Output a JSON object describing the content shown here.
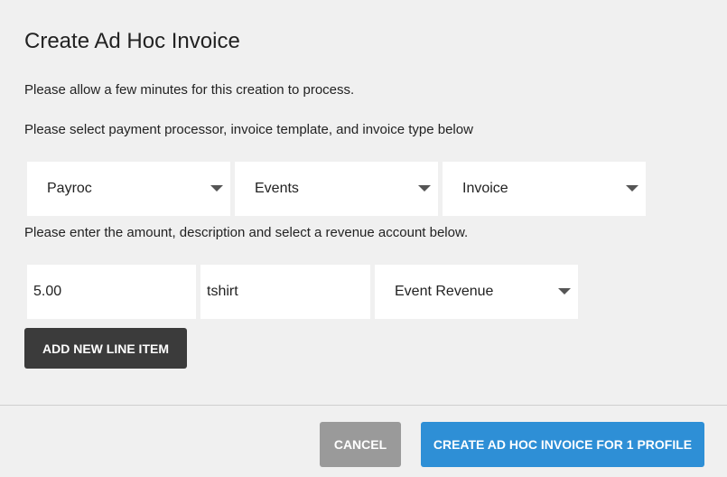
{
  "dialog": {
    "title": "Create Ad Hoc Invoice",
    "notice": "Please allow a few minutes for this creation to process.",
    "instructions_select": "Please select payment processor, invoice template, and invoice type below",
    "instructions_amount": "Please enter the amount, description and select a revenue account below."
  },
  "selectors": {
    "payment_processor": "Payroc",
    "invoice_template": "Events",
    "invoice_type": "Invoice"
  },
  "line_item": {
    "amount": "5.00",
    "description": "tshirt",
    "revenue_account": "Event Revenue"
  },
  "buttons": {
    "add_line_item": "ADD NEW LINE ITEM",
    "cancel": "CANCEL",
    "create": "CREATE AD HOC INVOICE FOR 1 PROFILE"
  },
  "colors": {
    "background": "#f0f0f0",
    "field_background": "#ffffff",
    "dark_button": "#3b3b3b",
    "cancel_button": "#9a9a9a",
    "primary_button": "#2e8fd6"
  },
  "icons": {
    "dropdown": "chevron-down-icon"
  }
}
